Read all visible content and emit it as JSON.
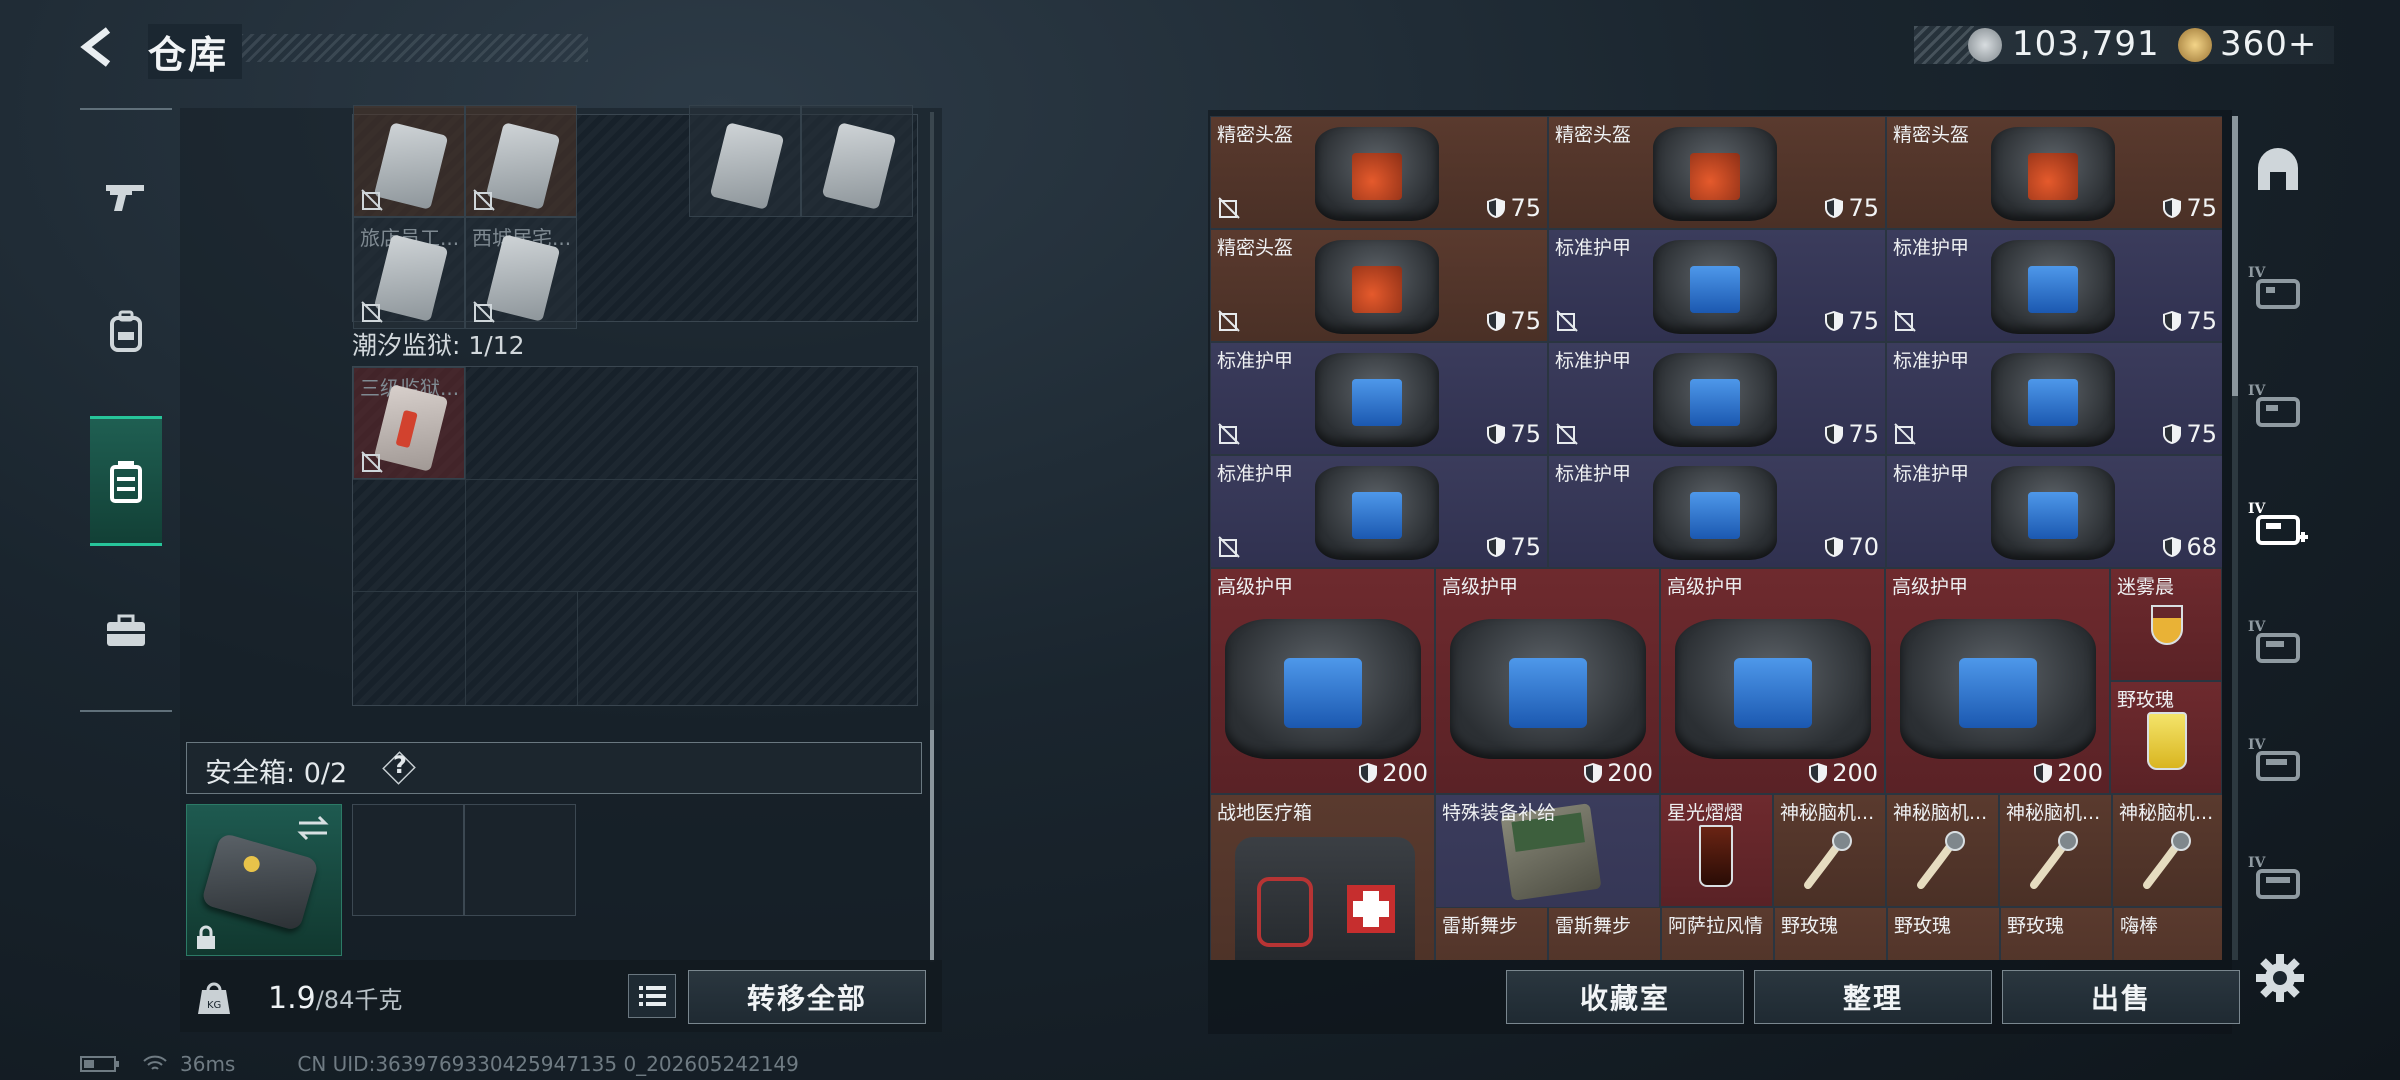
{
  "header": {
    "title": "仓库"
  },
  "currency": {
    "silver": "103,791",
    "gold": "360+",
    "silver_icon": "silver-coin-icon",
    "gold_icon": "gold-coin-icon"
  },
  "left_sidebar": {
    "items": [
      {
        "name": "weapon",
        "icon": "gun-icon"
      },
      {
        "name": "gear",
        "icon": "backpack-icon"
      },
      {
        "name": "storage",
        "icon": "container-icon",
        "active": true
      },
      {
        "name": "supplies",
        "icon": "toolbox-icon"
      }
    ]
  },
  "keys": {
    "top_cells": [
      {
        "label": "",
        "row": 0,
        "col": 0
      },
      {
        "label": "",
        "row": 0,
        "col": 1
      },
      {
        "label": "",
        "row": 0,
        "col": 3
      },
      {
        "label": "",
        "row": 0,
        "col": 4
      },
      {
        "label": "旅店员工...",
        "row": 1,
        "col": 0
      },
      {
        "label": "西城居宅...",
        "row": 1,
        "col": 1
      }
    ],
    "prison_label": "潮汐监狱: 1/12",
    "prison_cell": {
      "label": "三级监狱..."
    }
  },
  "safebox": {
    "label": "安全箱:",
    "count": "0/2",
    "help": "?"
  },
  "weight": {
    "current": "1.9",
    "max": "/84千克"
  },
  "buttons": {
    "transfer_all": "转移全部",
    "collection": "收藏室",
    "organize": "整理",
    "sell": "出售"
  },
  "items": [
    {
      "name": "精密头盔",
      "dur": "75",
      "style": "brown",
      "kind": "helmet",
      "x": 0,
      "y": 0,
      "w": 1,
      "h": 1,
      "nopick": true
    },
    {
      "name": "精密头盔",
      "dur": "75",
      "style": "brown",
      "kind": "helmet",
      "x": 1,
      "y": 0,
      "w": 1,
      "h": 1,
      "nopick": false
    },
    {
      "name": "精密头盔",
      "dur": "75",
      "style": "brown",
      "kind": "helmet",
      "x": 2,
      "y": 0,
      "w": 1,
      "h": 1,
      "nopick": false
    },
    {
      "name": "精密头盔",
      "dur": "75",
      "style": "brown",
      "kind": "helmet",
      "x": 0,
      "y": 1,
      "w": 1,
      "h": 1,
      "nopick": true
    },
    {
      "name": "标准护甲",
      "dur": "75",
      "style": "navy",
      "kind": "armor",
      "x": 1,
      "y": 1,
      "w": 1,
      "h": 1,
      "nopick": true
    },
    {
      "name": "标准护甲",
      "dur": "75",
      "style": "navy",
      "kind": "armor",
      "x": 2,
      "y": 1,
      "w": 1,
      "h": 1,
      "nopick": true
    },
    {
      "name": "标准护甲",
      "dur": "75",
      "style": "navy",
      "kind": "armor",
      "x": 0,
      "y": 2,
      "w": 1,
      "h": 1,
      "nopick": true
    },
    {
      "name": "标准护甲",
      "dur": "75",
      "style": "navy",
      "kind": "armor",
      "x": 1,
      "y": 2,
      "w": 1,
      "h": 1,
      "nopick": true
    },
    {
      "name": "标准护甲",
      "dur": "75",
      "style": "navy",
      "kind": "armor",
      "x": 2,
      "y": 2,
      "w": 1,
      "h": 1,
      "nopick": true
    },
    {
      "name": "标准护甲",
      "dur": "75",
      "style": "navy",
      "kind": "armor",
      "x": 0,
      "y": 3,
      "w": 1,
      "h": 1,
      "nopick": true
    },
    {
      "name": "标准护甲",
      "dur": "70",
      "style": "navy",
      "kind": "armor",
      "x": 1,
      "y": 3,
      "w": 1,
      "h": 1,
      "nopick": false
    },
    {
      "name": "标准护甲",
      "dur": "68",
      "style": "navy",
      "kind": "armor",
      "x": 2,
      "y": 3,
      "w": 1,
      "h": 1,
      "nopick": false
    }
  ],
  "big_items": [
    {
      "name": "高级护甲",
      "dur": "200",
      "col": 0
    },
    {
      "name": "高级护甲",
      "dur": "200",
      "col": 1
    },
    {
      "name": "高级护甲",
      "dur": "200",
      "col": 2
    },
    {
      "name": "高级护甲",
      "dur": "200",
      "col": 3
    }
  ],
  "drinks_side": [
    {
      "name": "迷雾晨",
      "row": 0
    },
    {
      "name": "野玫瑰",
      "row": 1
    }
  ],
  "bottom_row": [
    {
      "name": "战地医疗箱",
      "style": "brown",
      "kind": "medkit"
    },
    {
      "name": "特殊装备补给",
      "style": "navy",
      "kind": "crate"
    },
    {
      "name": "星光熠熠",
      "style": "red",
      "kind": "drink"
    },
    {
      "name": "神秘脑机...",
      "style": "brown",
      "kind": "chip"
    },
    {
      "name": "神秘脑机...",
      "style": "brown",
      "kind": "chip"
    },
    {
      "name": "神秘脑机...",
      "style": "brown",
      "kind": "chip"
    },
    {
      "name": "神秘脑机...",
      "style": "brown",
      "kind": "chip"
    }
  ],
  "partial_row": [
    "雷斯舞步",
    "雷斯舞步",
    "阿萨拉风情",
    "野玫瑰",
    "野玫瑰",
    "野玫瑰",
    "嗨棒"
  ],
  "right_sidebar": {
    "items": [
      {
        "name": "helmet-cat",
        "icon": "helmet-icon",
        "tier": ""
      },
      {
        "name": "armor-cat",
        "icon": "armor-icon",
        "tier": "IV"
      },
      {
        "name": "chest-cat",
        "icon": "chest-rig-icon",
        "tier": "IV"
      },
      {
        "name": "medical-cat",
        "icon": "medical-icon",
        "tier": "IV"
      },
      {
        "name": "tool-cat",
        "icon": "toolbox-icon",
        "tier": "IV"
      },
      {
        "name": "key-cat",
        "icon": "keycard-icon",
        "tier": "IV"
      },
      {
        "name": "misc-cat",
        "icon": "bag-icon",
        "tier": "IV"
      }
    ]
  },
  "status": {
    "ping": "36ms",
    "uid": "CN UID:3639769330425947135 0_202605242149"
  }
}
